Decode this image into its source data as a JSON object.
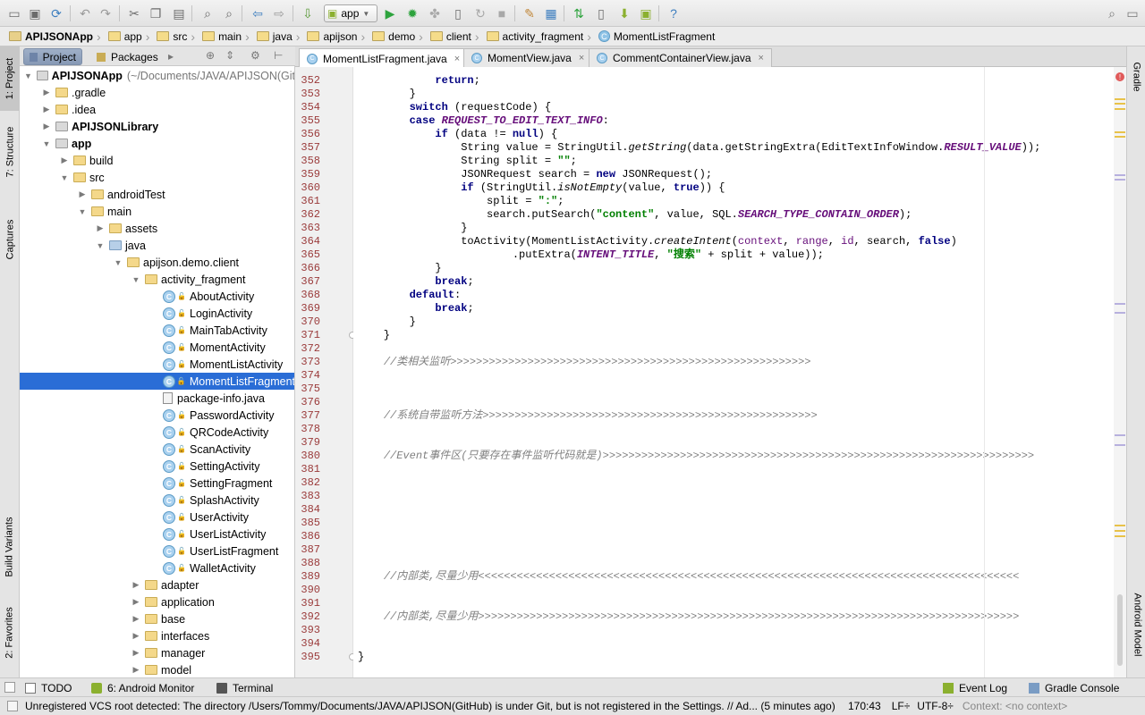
{
  "toolbar": {
    "run_config": "app"
  },
  "breadcrumb": [
    "APIJSONApp",
    "app",
    "src",
    "main",
    "java",
    "apijson",
    "demo",
    "client",
    "activity_fragment",
    "MomentListFragment"
  ],
  "left_strip": {
    "tabs": [
      "1: Project",
      "7: Structure",
      "Captures",
      "Build Variants",
      "2: Favorites"
    ]
  },
  "right_strip": {
    "tabs": [
      "Gradle",
      "Android Model"
    ]
  },
  "project_panel": {
    "tabs": [
      "Project",
      "Packages"
    ],
    "tree": [
      {
        "label": "APIJSONApp",
        "suffix": "(~/Documents/JAVA/APIJSON(Git",
        "indent": 0,
        "arrow": "down",
        "icon": "module",
        "bold": true
      },
      {
        "label": ".gradle",
        "indent": 1,
        "arrow": "right",
        "icon": "folder"
      },
      {
        "label": ".idea",
        "indent": 1,
        "arrow": "right",
        "icon": "folder"
      },
      {
        "label": "APIJSONLibrary",
        "indent": 1,
        "arrow": "right",
        "icon": "module",
        "bold": true
      },
      {
        "label": "app",
        "indent": 1,
        "arrow": "down",
        "icon": "module",
        "bold": true
      },
      {
        "label": "build",
        "indent": 2,
        "arrow": "right",
        "icon": "folder"
      },
      {
        "label": "src",
        "indent": 2,
        "arrow": "down",
        "icon": "folder"
      },
      {
        "label": "androidTest",
        "indent": 3,
        "arrow": "right",
        "icon": "folder"
      },
      {
        "label": "main",
        "indent": 3,
        "arrow": "down",
        "icon": "folder"
      },
      {
        "label": "assets",
        "indent": 4,
        "arrow": "right",
        "icon": "folder"
      },
      {
        "label": "java",
        "indent": 4,
        "arrow": "down",
        "icon": "src"
      },
      {
        "label": "apijson.demo.client",
        "indent": 5,
        "arrow": "down",
        "icon": "folder"
      },
      {
        "label": "activity_fragment",
        "indent": 6,
        "arrow": "down",
        "icon": "folder"
      },
      {
        "label": "AboutActivity",
        "indent": 7,
        "arrow": "",
        "icon": "class"
      },
      {
        "label": "LoginActivity",
        "indent": 7,
        "arrow": "",
        "icon": "class"
      },
      {
        "label": "MainTabActivity",
        "indent": 7,
        "arrow": "",
        "icon": "class"
      },
      {
        "label": "MomentActivity",
        "indent": 7,
        "arrow": "",
        "icon": "class"
      },
      {
        "label": "MomentListActivity",
        "indent": 7,
        "arrow": "",
        "icon": "class"
      },
      {
        "label": "MomentListFragment",
        "indent": 7,
        "arrow": "",
        "icon": "class",
        "selected": true
      },
      {
        "label": "package-info.java",
        "indent": 7,
        "arrow": "",
        "icon": "file"
      },
      {
        "label": "PasswordActivity",
        "indent": 7,
        "arrow": "",
        "icon": "class"
      },
      {
        "label": "QRCodeActivity",
        "indent": 7,
        "arrow": "",
        "icon": "class"
      },
      {
        "label": "ScanActivity",
        "indent": 7,
        "arrow": "",
        "icon": "class"
      },
      {
        "label": "SettingActivity",
        "indent": 7,
        "arrow": "",
        "icon": "class"
      },
      {
        "label": "SettingFragment",
        "indent": 7,
        "arrow": "",
        "icon": "class"
      },
      {
        "label": "SplashActivity",
        "indent": 7,
        "arrow": "",
        "icon": "class"
      },
      {
        "label": "UserActivity",
        "indent": 7,
        "arrow": "",
        "icon": "class"
      },
      {
        "label": "UserListActivity",
        "indent": 7,
        "arrow": "",
        "icon": "class"
      },
      {
        "label": "UserListFragment",
        "indent": 7,
        "arrow": "",
        "icon": "class"
      },
      {
        "label": "WalletActivity",
        "indent": 7,
        "arrow": "",
        "icon": "class"
      },
      {
        "label": "adapter",
        "indent": 6,
        "arrow": "right",
        "icon": "folder"
      },
      {
        "label": "application",
        "indent": 6,
        "arrow": "right",
        "icon": "folder"
      },
      {
        "label": "base",
        "indent": 6,
        "arrow": "right",
        "icon": "folder"
      },
      {
        "label": "interfaces",
        "indent": 6,
        "arrow": "right",
        "icon": "folder"
      },
      {
        "label": "manager",
        "indent": 6,
        "arrow": "right",
        "icon": "folder"
      },
      {
        "label": "model",
        "indent": 6,
        "arrow": "right",
        "icon": "folder"
      }
    ]
  },
  "editor": {
    "tabs": [
      {
        "label": "MomentListFragment.java",
        "active": true
      },
      {
        "label": "MomentView.java",
        "active": false
      },
      {
        "label": "CommentContainerView.java",
        "active": false
      }
    ],
    "first_line": 352,
    "lines": [
      [
        [
          "            ",
          ""
        ],
        [
          "return",
          "kw"
        ],
        [
          ";",
          ""
        ]
      ],
      [
        [
          "        }",
          ""
        ]
      ],
      [
        [
          "        ",
          ""
        ],
        [
          "switch",
          "kw"
        ],
        [
          " (requestCode) {",
          ""
        ]
      ],
      [
        [
          "        ",
          ""
        ],
        [
          "case ",
          "kw"
        ],
        [
          "REQUEST_TO_EDIT_TEXT_INFO",
          "fi"
        ],
        [
          ":",
          ""
        ]
      ],
      [
        [
          "            ",
          ""
        ],
        [
          "if",
          "kw"
        ],
        [
          " (data != ",
          ""
        ],
        [
          "null",
          "kw"
        ],
        [
          ") {",
          ""
        ]
      ],
      [
        [
          "                String value = StringUtil.",
          ""
        ],
        [
          "getString",
          "me"
        ],
        [
          "(data.getStringExtra(EditTextInfoWindow.",
          ""
        ],
        [
          "RESULT_VALUE",
          "fi"
        ],
        [
          "));",
          ""
        ]
      ],
      [
        [
          "                String split = ",
          ""
        ],
        [
          "\"\"",
          "st"
        ],
        [
          ";",
          ""
        ]
      ],
      [
        [
          "                JSONRequest search = ",
          ""
        ],
        [
          "new",
          "kw"
        ],
        [
          " JSONRequest();",
          ""
        ]
      ],
      [
        [
          "                ",
          ""
        ],
        [
          "if",
          "kw"
        ],
        [
          " (StringUtil.",
          ""
        ],
        [
          "isNotEmpty",
          "me"
        ],
        [
          "(value, ",
          ""
        ],
        [
          "true",
          "kw"
        ],
        [
          ")) {",
          ""
        ]
      ],
      [
        [
          "                    split = ",
          ""
        ],
        [
          "\":\"",
          "st"
        ],
        [
          ";",
          ""
        ]
      ],
      [
        [
          "                    search.putSearch(",
          ""
        ],
        [
          "\"content\"",
          "st"
        ],
        [
          ", value, SQL.",
          ""
        ],
        [
          "SEARCH_TYPE_CONTAIN_ORDER",
          "fi"
        ],
        [
          ");",
          ""
        ]
      ],
      [
        [
          "                }",
          ""
        ]
      ],
      [
        [
          "                toActivity(MomentListActivity.",
          ""
        ],
        [
          "createIntent",
          "me"
        ],
        [
          "(",
          ""
        ],
        [
          "context",
          "pm"
        ],
        [
          ", ",
          ""
        ],
        [
          "range",
          "pm"
        ],
        [
          ", ",
          ""
        ],
        [
          "id",
          "pm"
        ],
        [
          ", search, ",
          ""
        ],
        [
          "false",
          "kw"
        ],
        [
          ")",
          ""
        ]
      ],
      [
        [
          "                        .putExtra(",
          ""
        ],
        [
          "INTENT_TITLE",
          "fi"
        ],
        [
          ", ",
          ""
        ],
        [
          "\"搜索\"",
          "st"
        ],
        [
          " + split + value));",
          ""
        ]
      ],
      [
        [
          "            }",
          ""
        ]
      ],
      [
        [
          "            ",
          ""
        ],
        [
          "break",
          "kw"
        ],
        [
          ";",
          ""
        ]
      ],
      [
        [
          "        ",
          ""
        ],
        [
          "default",
          "kw"
        ],
        [
          ":",
          ""
        ]
      ],
      [
        [
          "            ",
          ""
        ],
        [
          "break",
          "kw"
        ],
        [
          ";",
          ""
        ]
      ],
      [
        [
          "        }",
          ""
        ]
      ],
      [
        [
          "    }",
          ""
        ]
      ],
      [
        [
          "",
          ""
        ]
      ],
      [
        [
          "    ",
          ""
        ],
        [
          "//类相关监听>>>>>>>>>>>>>>>>>>>>>>>>>>>>>>>>>>>>>>>>>>>>>>>>>>>>>>>>",
          "cm"
        ]
      ],
      [
        [
          "",
          ""
        ]
      ],
      [
        [
          "",
          ""
        ]
      ],
      [
        [
          "",
          ""
        ]
      ],
      [
        [
          "    ",
          ""
        ],
        [
          "//系统自带监听方法>>>>>>>>>>>>>>>>>>>>>>>>>>>>>>>>>>>>>>>>>>>>>>>>>>>>",
          "cm"
        ]
      ],
      [
        [
          "",
          ""
        ]
      ],
      [
        [
          "",
          ""
        ]
      ],
      [
        [
          "    ",
          ""
        ],
        [
          "//Event事件区(只要存在事件监听代码就是)>>>>>>>>>>>>>>>>>>>>>>>>>>>>>>>>>>>>>>>>>>>>>>>>>>>>>>>>>>>>>>>>>>>",
          "cm"
        ]
      ],
      [
        [
          "",
          ""
        ]
      ],
      [
        [
          "",
          ""
        ]
      ],
      [
        [
          "",
          ""
        ]
      ],
      [
        [
          "",
          ""
        ]
      ],
      [
        [
          "",
          ""
        ]
      ],
      [
        [
          "",
          ""
        ]
      ],
      [
        [
          "",
          ""
        ]
      ],
      [
        [
          "",
          ""
        ]
      ],
      [
        [
          "    ",
          ""
        ],
        [
          "//内部类,尽量少用<<<<<<<<<<<<<<<<<<<<<<<<<<<<<<<<<<<<<<<<<<<<<<<<<<<<<<<<<<<<<<<<<<<<<<<<<<<<<<<<<<<<",
          "cm"
        ]
      ],
      [
        [
          "",
          ""
        ]
      ],
      [
        [
          "",
          ""
        ]
      ],
      [
        [
          "    ",
          ""
        ],
        [
          "//内部类,尽量少用>>>>>>>>>>>>>>>>>>>>>>>>>>>>>>>>>>>>>>>>>>>>>>>>>>>>>>>>>>>>>>>>>>>>>>>>>>>>>>>>>>>>",
          "cm"
        ]
      ],
      [
        [
          "",
          ""
        ]
      ],
      [
        [
          "",
          ""
        ]
      ],
      [
        [
          "}",
          ""
        ]
      ]
    ]
  },
  "bottom_tools": {
    "todo": "TODO",
    "android_monitor": "6: Android Monitor",
    "terminal": "Terminal",
    "event_log": "Event Log",
    "gradle_console": "Gradle Console"
  },
  "status": {
    "message": "Unregistered VCS root detected: The directory /Users/Tommy/Documents/JAVA/APIJSON(GitHub) is under Git, but is not registered in the Settings. // Ad... (5 minutes ago)",
    "position": "170:43",
    "line_sep": "LF÷",
    "encoding": "UTF-8÷",
    "context": "Context: <no context>"
  },
  "colors": {
    "selection": "#2a6dd6",
    "keyword": "#000080",
    "string": "#008000",
    "comment": "#808080",
    "constant": "#660e7a",
    "line_number": "#9a3a3a"
  }
}
